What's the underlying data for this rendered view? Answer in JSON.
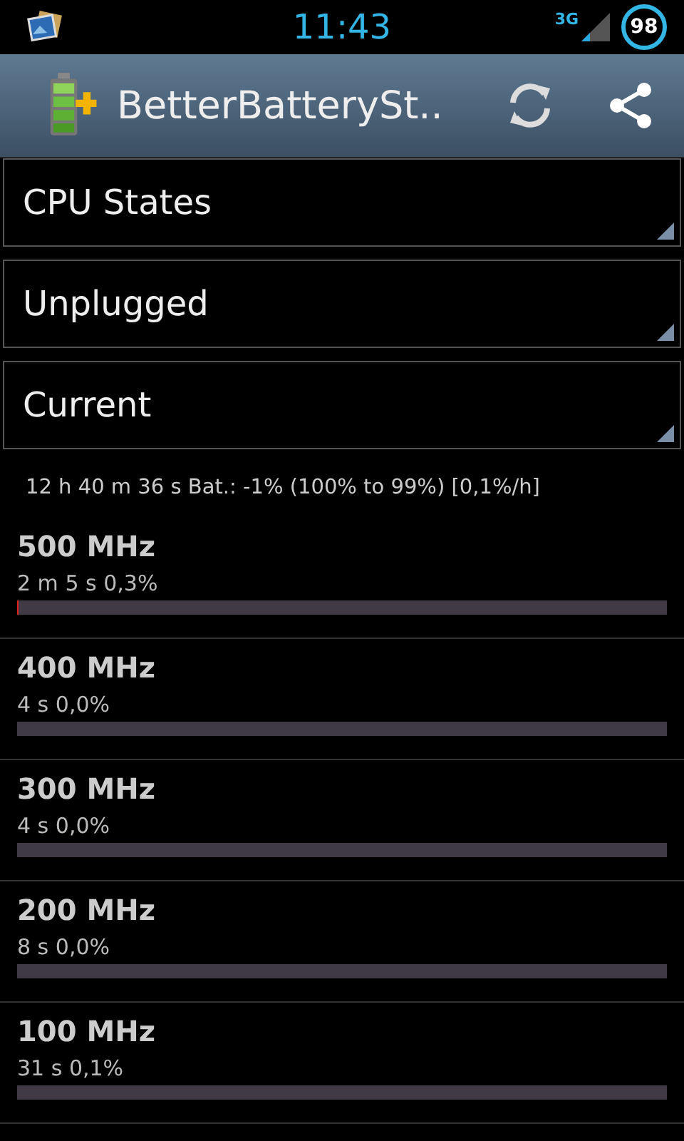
{
  "status_bar": {
    "time": "11:43",
    "network": "3G",
    "battery": "98"
  },
  "action_bar": {
    "title": "BetterBatterySt.."
  },
  "spinners": [
    {
      "value": "CPU States"
    },
    {
      "value": "Unplugged"
    },
    {
      "value": "Current"
    }
  ],
  "summary": "12 h 40 m 36 s  Bat.: -1% (100% to 99%) [0,1%/h]",
  "states": [
    {
      "name": "500 MHz",
      "detail": "2 m 5 s  0,3%",
      "level": 0.003
    },
    {
      "name": "400 MHz",
      "detail": "4 s  0,0%"
    },
    {
      "name": "300 MHz",
      "detail": "4 s  0,0%"
    },
    {
      "name": "200 MHz",
      "detail": "8 s  0,0%"
    },
    {
      "name": "100 MHz",
      "detail": "31 s  0,1%"
    }
  ]
}
